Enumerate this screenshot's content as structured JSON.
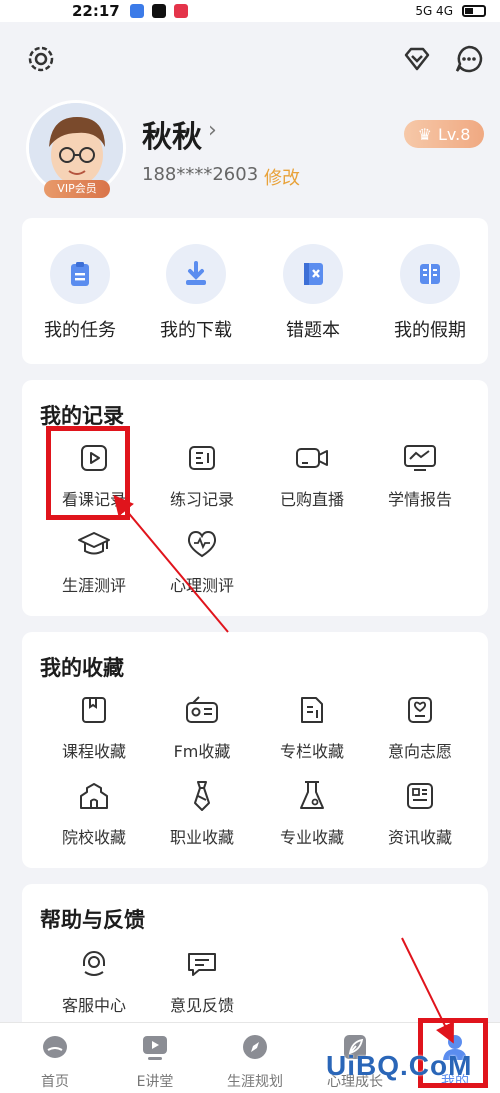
{
  "status_bar": {
    "time": "22:17",
    "signal_text": "5G 4G"
  },
  "profile": {
    "username": "秋秋",
    "phone": "188****2603",
    "edit_label": "修改",
    "vip_label": "VIP会员",
    "level_label": "Lv.8"
  },
  "quick_actions": [
    {
      "label": "我的任务",
      "icon": "clipboard-icon"
    },
    {
      "label": "我的下载",
      "icon": "download-icon"
    },
    {
      "label": "错题本",
      "icon": "wrongbook-icon"
    },
    {
      "label": "我的假期",
      "icon": "holiday-book-icon"
    }
  ],
  "records": {
    "title": "我的记录",
    "items": [
      {
        "label": "看课记录",
        "icon": "play-icon"
      },
      {
        "label": "练习记录",
        "icon": "practice-icon"
      },
      {
        "label": "已购直播",
        "icon": "live-camera-icon"
      },
      {
        "label": "学情报告",
        "icon": "report-monitor-icon"
      },
      {
        "label": "生涯测评",
        "icon": "graduation-cap-icon"
      },
      {
        "label": "心理测评",
        "icon": "heart-pulse-icon"
      }
    ]
  },
  "favorites": {
    "title": "我的收藏",
    "items": [
      {
        "label": "课程收藏",
        "icon": "bookmark-book-icon"
      },
      {
        "label": "Fm收藏",
        "icon": "radio-icon"
      },
      {
        "label": "专栏收藏",
        "icon": "column-doc-icon"
      },
      {
        "label": "意向志愿",
        "icon": "heart-card-icon"
      },
      {
        "label": "院校收藏",
        "icon": "school-icon"
      },
      {
        "label": "职业收藏",
        "icon": "tie-icon"
      },
      {
        "label": "专业收藏",
        "icon": "flask-icon"
      },
      {
        "label": "资讯收藏",
        "icon": "news-icon"
      }
    ]
  },
  "help": {
    "title": "帮助与反馈",
    "items": [
      {
        "label": "客服中心",
        "icon": "headset-icon"
      },
      {
        "label": "意见反馈",
        "icon": "feedback-icon"
      }
    ]
  },
  "tabbar": [
    {
      "label": "首页",
      "icon": "home-tab-icon"
    },
    {
      "label": "E讲堂",
      "icon": "video-tab-icon"
    },
    {
      "label": "生涯规划",
      "icon": "compass-tab-icon"
    },
    {
      "label": "心理成长",
      "icon": "leaf-tab-icon"
    },
    {
      "label": "我的",
      "icon": "me-tab-icon"
    }
  ],
  "watermark": "UiBQ.CoM",
  "colors": {
    "accent_blue": "#5b8def",
    "edit_orange": "#e8a23a",
    "annotation_red": "#e0141c",
    "icon_gray": "#333333"
  }
}
